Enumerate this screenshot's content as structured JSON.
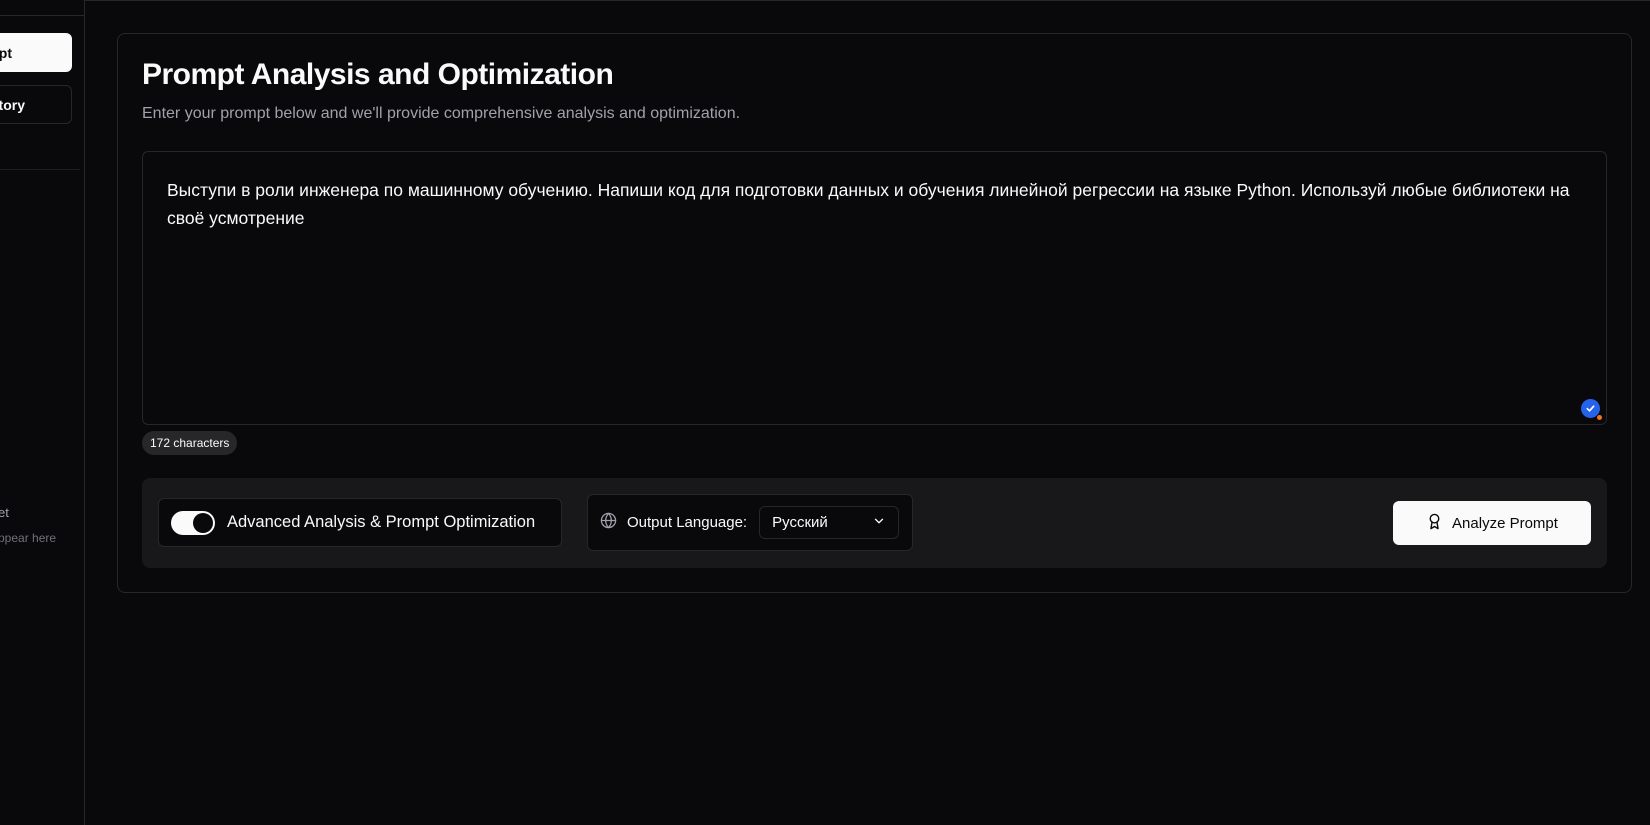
{
  "sidebar": {
    "primary_button": "pt",
    "secondary_button": "tory",
    "empty_title": "et",
    "empty_subtitle": "ppear here"
  },
  "main": {
    "title": "Prompt Analysis and Optimization",
    "subtitle": "Enter your prompt below and we'll provide comprehensive analysis and optimization.",
    "prompt_text": "Выступи в роли инженера по машинному обучению. Напиши код для подготовки данных и обучения линейной регрессии на языке Python. Используй любые библиотеки на своё усмотрение",
    "char_count": "172 characters"
  },
  "controls": {
    "toggle_label": "Advanced Analysis & Prompt Optimization",
    "toggle_on": true,
    "language_label": "Output Language:",
    "language_value": "Русский",
    "analyze_button": "Analyze Prompt"
  },
  "icons": {
    "language": "globe-icon",
    "select": "chevron-down-icon",
    "analyze": "award-icon",
    "status": "check-badge-icon"
  },
  "colors": {
    "background": "#09090b",
    "border": "#27272a",
    "panel": "#18181b",
    "primary": "#fafafa",
    "muted": "#a1a1aa",
    "accent_blue": "#2563eb",
    "accent_orange": "#f97316"
  }
}
